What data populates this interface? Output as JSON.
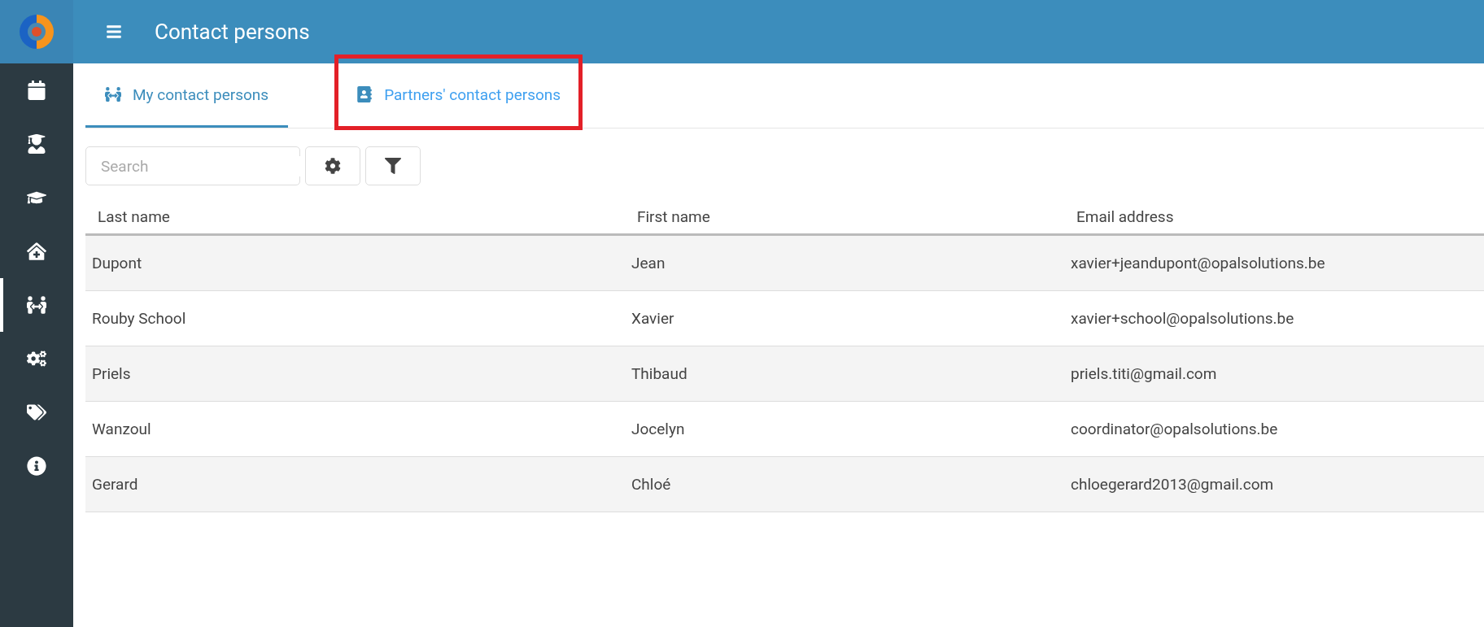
{
  "header": {
    "title": "Contact persons"
  },
  "sidebar": {
    "items": [
      {
        "kind": "calendar",
        "selected": false
      },
      {
        "kind": "graduate",
        "selected": false
      },
      {
        "kind": "cap",
        "selected": false
      },
      {
        "kind": "house",
        "selected": false
      },
      {
        "kind": "people",
        "selected": true
      },
      {
        "kind": "gears",
        "selected": false
      },
      {
        "kind": "tags",
        "selected": false
      },
      {
        "kind": "info",
        "selected": false
      }
    ]
  },
  "tabs": [
    {
      "label": "My contact persons",
      "kind": "people",
      "selected": true,
      "highlighted": false
    },
    {
      "label": "Partners' contact persons",
      "kind": "contacts",
      "selected": false,
      "highlighted": true
    }
  ],
  "search": {
    "placeholder": "Search"
  },
  "table": {
    "columns": [
      "Last name",
      "First name",
      "Email address"
    ],
    "rows": [
      [
        "Dupont",
        "Jean",
        "xavier+jeandupont@opalsolutions.be"
      ],
      [
        "Rouby School",
        "Xavier",
        "xavier+school@opalsolutions.be"
      ],
      [
        "Priels",
        "Thibaud",
        "priels.titi@gmail.com"
      ],
      [
        "Wanzoul",
        "Jocelyn",
        "coordinator@opalsolutions.be"
      ],
      [
        "Gerard",
        "Chloé",
        "chloegerard2013@gmail.com"
      ]
    ]
  }
}
